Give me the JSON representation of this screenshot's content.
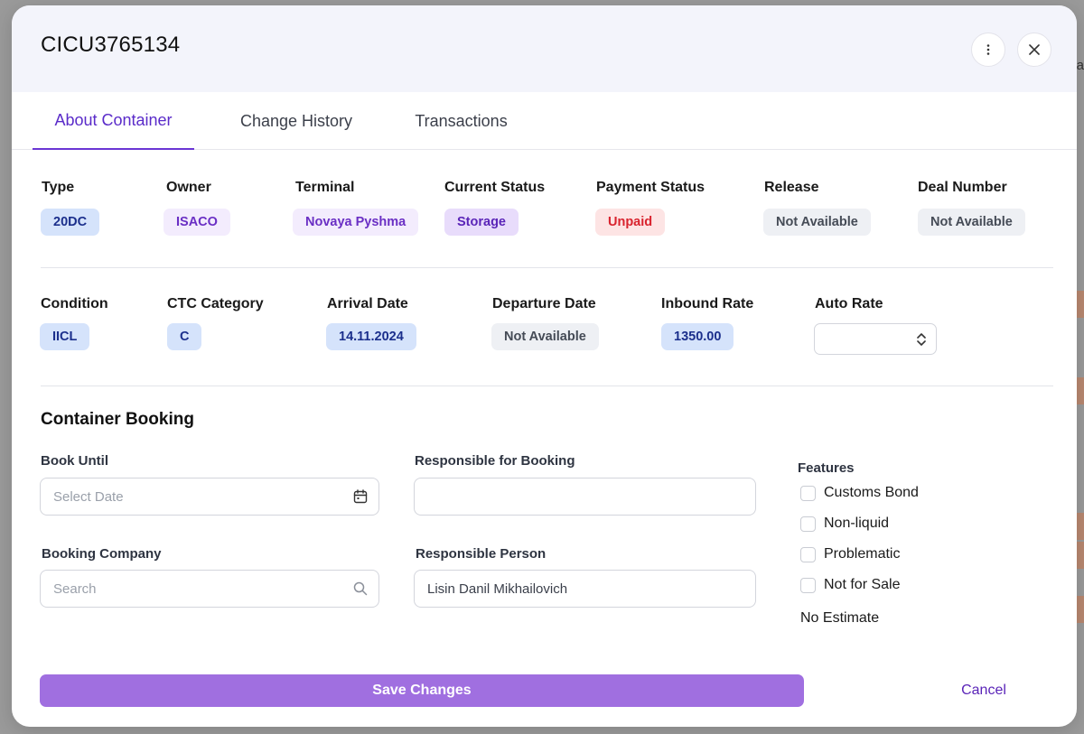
{
  "modal": {
    "title": "CICU3765134"
  },
  "background": {
    "edge_text": "a"
  },
  "tabs": [
    {
      "label": "About Container",
      "active": true
    },
    {
      "label": "Change History",
      "active": false
    },
    {
      "label": "Transactions",
      "active": false
    }
  ],
  "info_row1": [
    {
      "label": "Type",
      "value": "20DC",
      "style": "blue"
    },
    {
      "label": "Owner",
      "value": "ISACO",
      "style": "purple"
    },
    {
      "label": "Terminal",
      "value": "Novaya Pyshma",
      "style": "purple"
    },
    {
      "label": "Current Status",
      "value": "Storage",
      "style": "purple2"
    },
    {
      "label": "Payment Status",
      "value": "Unpaid",
      "style": "red"
    },
    {
      "label": "Release",
      "value": "Not Available",
      "style": "gray"
    },
    {
      "label": "Deal Number",
      "value": "Not Available",
      "style": "gray"
    }
  ],
  "info_row2": [
    {
      "label": "Condition",
      "value": "IICL",
      "style": "blue"
    },
    {
      "label": "CTC Category",
      "value": "C",
      "style": "blue"
    },
    {
      "label": "Arrival Date",
      "value": "14.11.2024",
      "style": "blue"
    },
    {
      "label": "Departure Date",
      "value": "Not Available",
      "style": "gray"
    },
    {
      "label": "Inbound Rate",
      "value": "1350.00",
      "style": "blue"
    },
    {
      "label": "Auto Rate",
      "value": "",
      "style": "select"
    }
  ],
  "booking": {
    "section_title": "Container Booking",
    "book_until_label": "Book Until",
    "book_until_placeholder": "Select Date",
    "responsible_booking_label": "Responsible for Booking",
    "responsible_booking_value": "",
    "booking_company_label": "Booking Company",
    "booking_company_placeholder": "Search",
    "responsible_person_label": "Responsible Person",
    "responsible_person_value": "Lisin Danil Mikhailovich"
  },
  "features": {
    "label": "Features",
    "items": [
      {
        "label": "Customs Bond",
        "checked": false
      },
      {
        "label": "Non-liquid",
        "checked": false
      },
      {
        "label": "Problematic",
        "checked": false
      },
      {
        "label": "Not for Sale",
        "checked": false
      }
    ],
    "no_estimate": "No Estimate"
  },
  "actions": {
    "save_label": "Save Changes",
    "cancel_label": "Cancel"
  },
  "colors": {
    "accent": "#6a36d4",
    "save_button": "#a06fe0",
    "unpaid_red": "#d9232e"
  }
}
